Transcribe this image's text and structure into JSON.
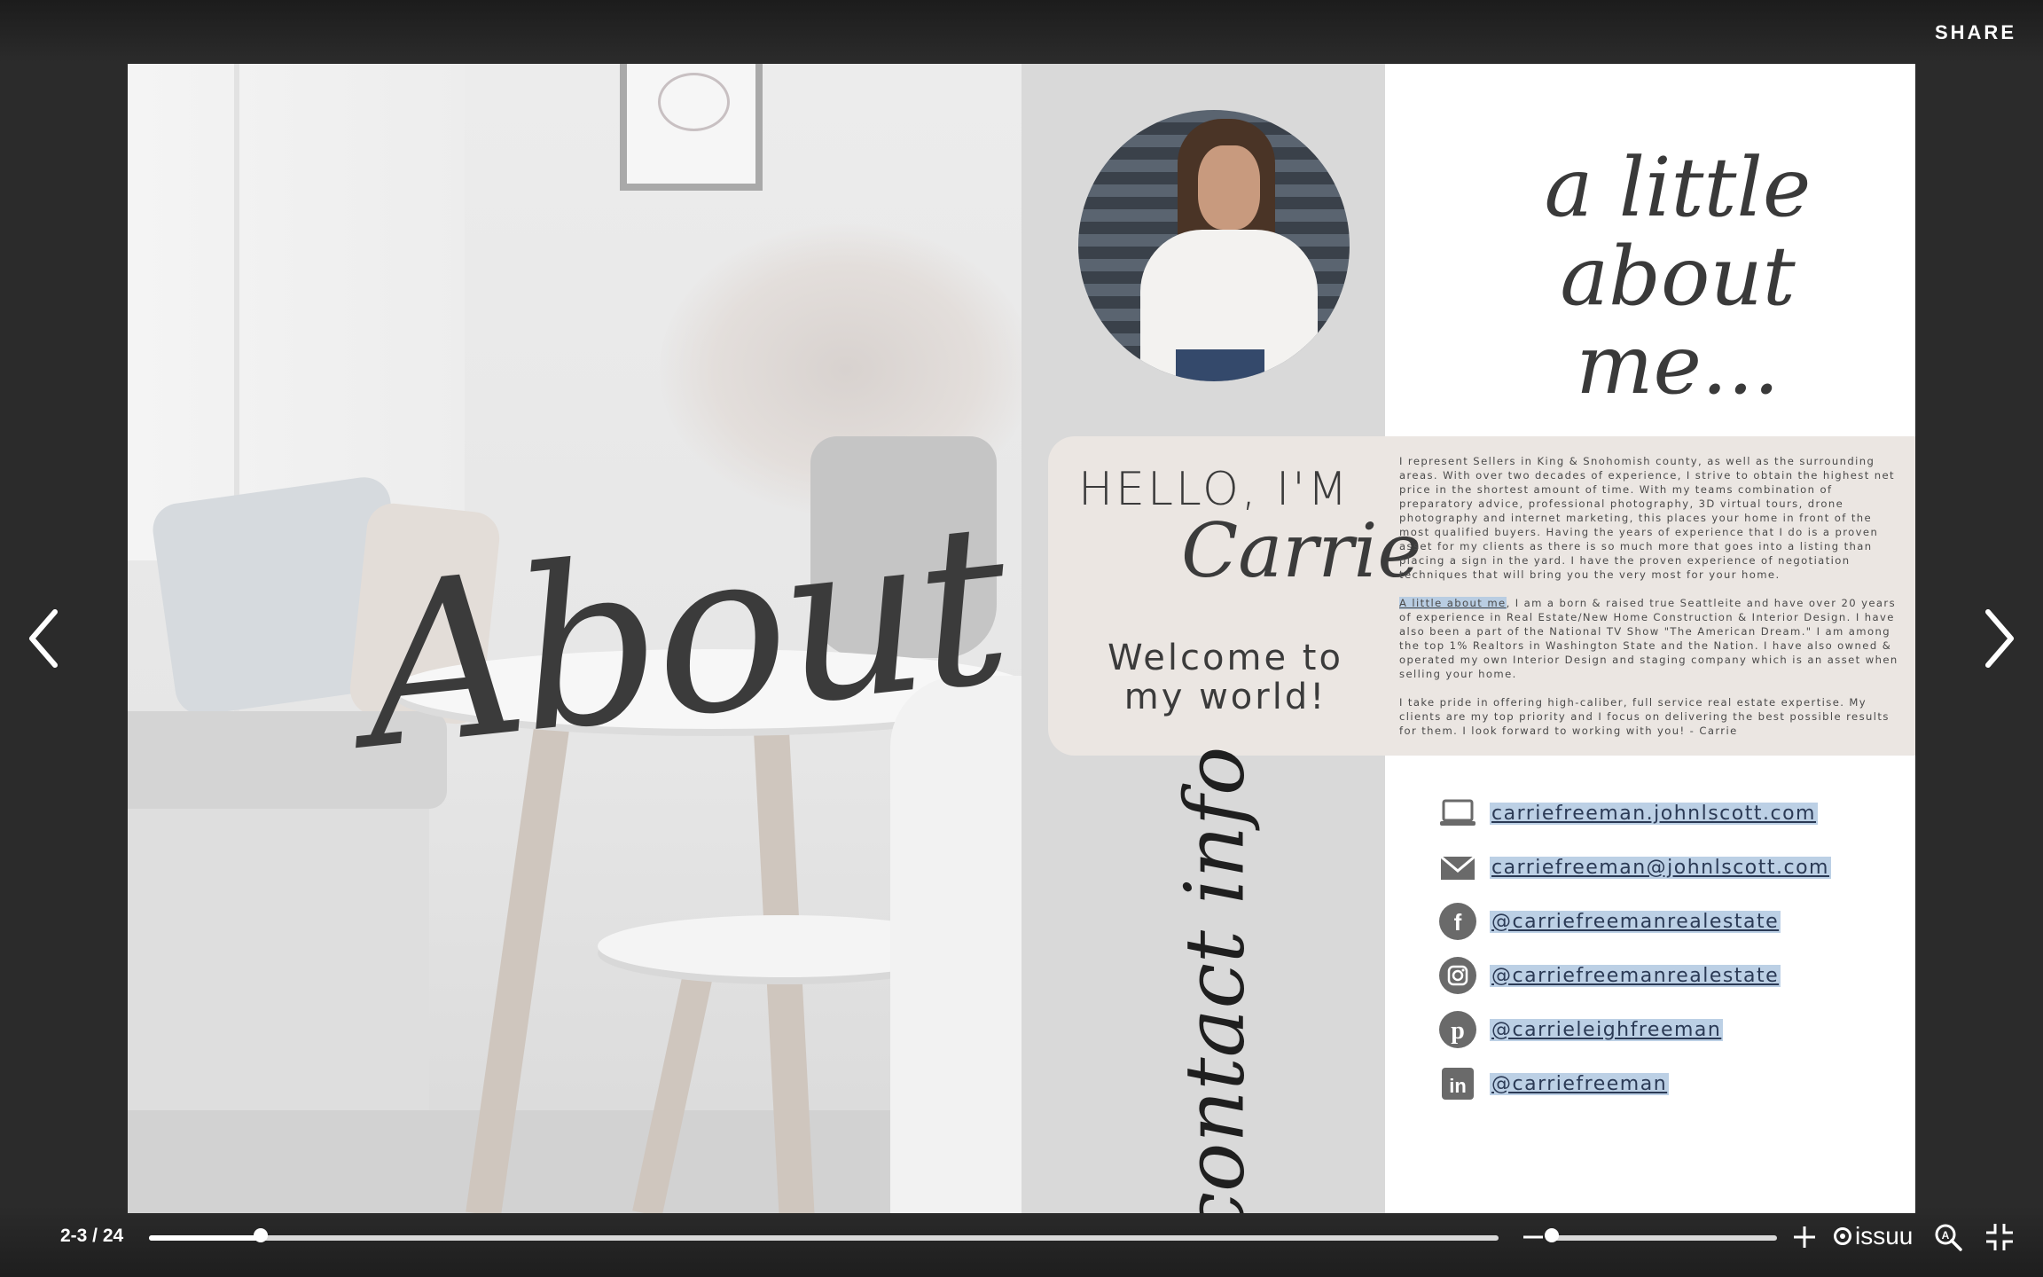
{
  "toolbar": {
    "share_label": "SHARE"
  },
  "nav": {
    "prev_icon": "chevron-left-icon",
    "next_icon": "chevron-right-icon"
  },
  "left_page": {
    "title": "About"
  },
  "right_page": {
    "heading_line1": "a little",
    "heading_line2": "about me...",
    "hello": "HELLO, I'M",
    "name": "Carrie",
    "welcome_line1": "Welcome to",
    "welcome_line2": "my world!",
    "bio_p1": "I represent Sellers in King & Snohomish county, as well as the surrounding areas. With over two decades of experience, I strive to obtain the highest net price in the shortest amount of time. With my teams combination of preparatory advice, professional photography, 3D virtual tours, drone photography and internet marketing, this places your home in front of the most qualified buyers. Having the years of experience that I do is a proven asset for my clients as there is so much more that goes into a listing than placing a sign in the yard. I have the proven experience of negotiation techniques that will bring you the very most for your home.",
    "bio_p2_highlight": "A little about me",
    "bio_p2_rest": ", I am a born & raised true Seattleite and have over 20 years of experience in Real Estate/New Home Construction & Interior Design. I have also been a part of the National TV Show \"The American Dream.\" I am among the top 1% Realtors in Washington State and the Nation. I have also owned & operated my own Interior Design and staging company which is an asset when selling your home.",
    "bio_p3": "I take pride in offering high-caliber, full service real estate expertise. My clients are my top priority and I focus on delivering the best possible results for them. I look forward to working with you! - Carrie",
    "contact_title": "contact info",
    "contacts": [
      {
        "icon": "laptop-icon",
        "text": "carriefreeman.johnlscott.com"
      },
      {
        "icon": "envelope-icon",
        "text": "carriefreeman@johnlscott.com"
      },
      {
        "icon": "facebook-icon",
        "text": "@carriefreemanrealestate"
      },
      {
        "icon": "instagram-icon",
        "text": "@carriefreemanrealestate"
      },
      {
        "icon": "pinterest-icon",
        "text": "@carrieleighfreeman"
      },
      {
        "icon": "linkedin-icon",
        "text": "@carriefreeman"
      }
    ]
  },
  "bottom_bar": {
    "page_count": "2-3 / 24",
    "progress_fraction": 0.083,
    "zoom_fraction": 0.0,
    "brand": "issuu"
  }
}
